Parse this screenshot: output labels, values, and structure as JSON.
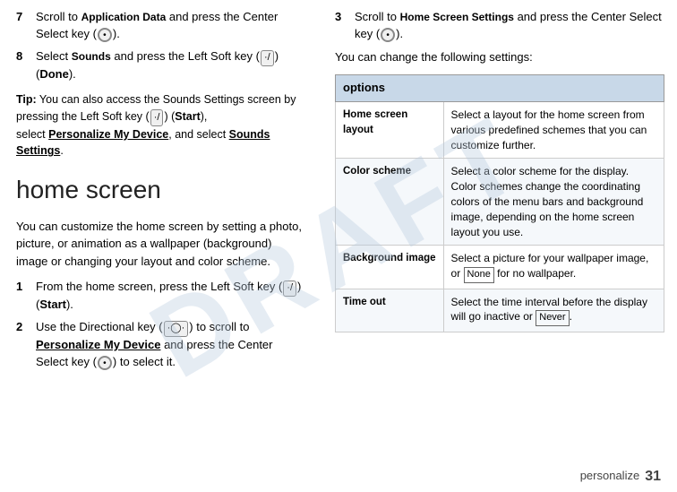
{
  "watermark": "DRAFT",
  "left": {
    "steps": [
      {
        "num": "7",
        "text": "Scroll to ",
        "app": "Application Data",
        "mid": " and press the Center Select key (",
        "key": "•",
        "end": ")."
      },
      {
        "num": "8",
        "text": "Select ",
        "app": "Sounds",
        "mid": " and press the Left Soft key (",
        "key": "•/",
        "end": ") (Done)."
      }
    ],
    "tip": {
      "prefix": "Tip:",
      "text": " You can also access the Sounds Settings screen by pressing the Left Soft key (",
      "key": "•/",
      "mid": ") (Start), select ",
      "bold1": "Personalize My Device",
      "mid2": ", and select ",
      "bold2": "Sounds Settings",
      "end": "."
    },
    "section_title": "home screen",
    "section_desc": "You can customize the home screen by setting a photo, picture, or animation as a wallpaper (background) image or changing your layout and color scheme.",
    "steps2": [
      {
        "num": "1",
        "text": "From the home screen, press the Left Soft key (",
        "key": "•/",
        "end": ") (Start)."
      },
      {
        "num": "2",
        "text": "Use the Directional key (",
        "key": "•◯•",
        "mid": ") to scroll to ",
        "bold": "Personalize My Device",
        "mid2": " and press the Center Select key (",
        "key2": "•",
        "end": ") to select it."
      }
    ]
  },
  "right": {
    "step3": {
      "num": "3",
      "text": "Scroll to ",
      "app": "Home Screen Settings",
      "mid": " and press the Center Select key (",
      "key": "•",
      "end": ")."
    },
    "intro": "You can change the following settings:",
    "table": {
      "header": "options",
      "rows": [
        {
          "option": "Home screen layout",
          "description": "Select a layout for the home screen from various predefined schemes that you can customize further."
        },
        {
          "option": "Color scheme",
          "description": "Select a color scheme for the display. Color schemes change the coordinating colors of the menu bars and background image, depending on the home screen layout you use."
        },
        {
          "option": "Background image",
          "description": "Select a picture for your wallpaper image, or None for no wallpaper."
        },
        {
          "option": "Time out",
          "description": "Select the time interval before the display will go inactive or Never."
        }
      ]
    }
  },
  "footer": {
    "label": "personalize",
    "page": "31"
  },
  "select_key_labels": [
    "Select key",
    "Select key"
  ]
}
